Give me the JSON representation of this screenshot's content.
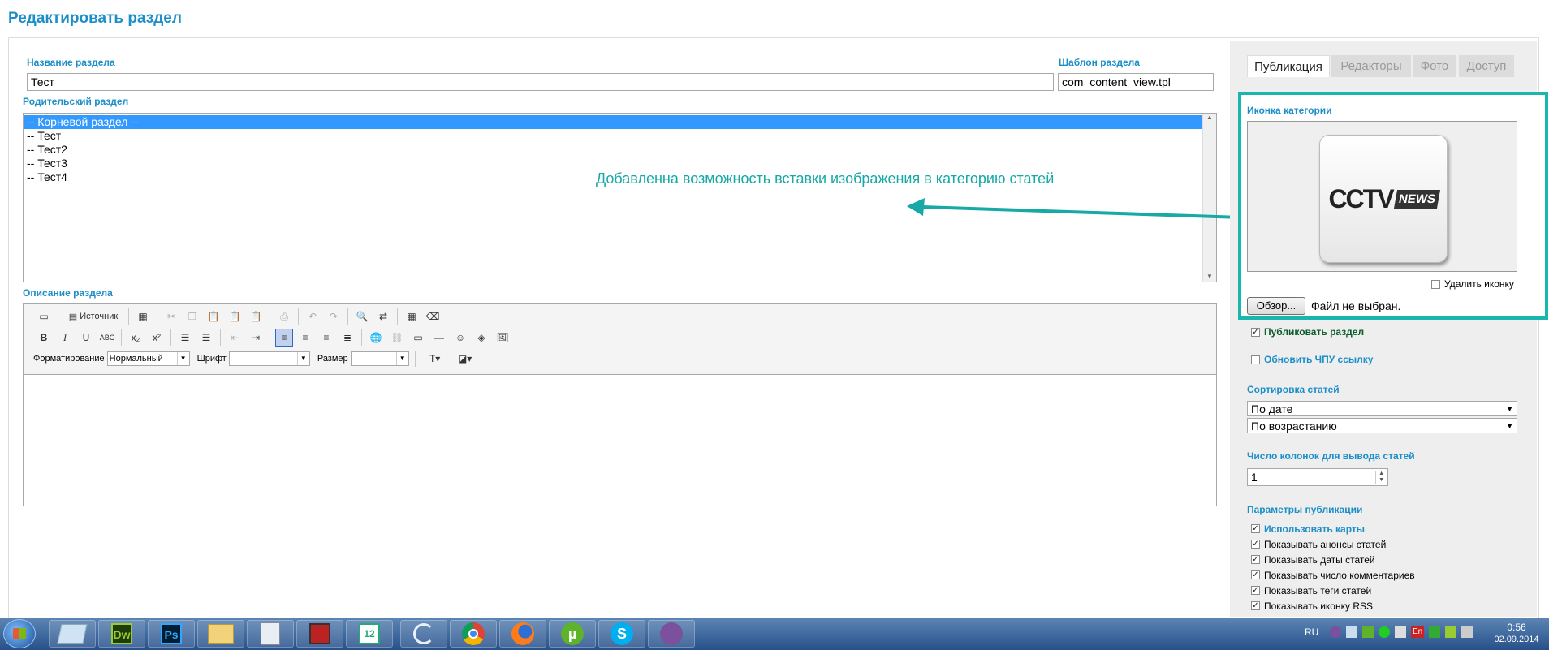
{
  "page": {
    "title": "Редактировать раздел"
  },
  "form": {
    "name_label": "Название раздела",
    "name_value": "Тест",
    "template_label": "Шаблон раздела",
    "template_value": "com_content_view.tpl",
    "parent_label": "Родительский раздел",
    "parent_items": [
      "-- Корневой раздел --",
      "-- Тест",
      "-- Тест2",
      "-- Тест3",
      "-- Тест4"
    ],
    "description_label": "Описание раздела"
  },
  "annotation": {
    "text": "Добавленна возможность вставки изображения в категорию статей",
    "color": "#17a9a5"
  },
  "editor": {
    "source_label": "Источник",
    "format_label": "Форматирование",
    "format_value": "Нормальный",
    "font_label": "Шрифт",
    "font_value": "",
    "size_label": "Размер",
    "size_value": ""
  },
  "tabs": [
    {
      "label": "Публикация",
      "active": true
    },
    {
      "label": "Редакторы",
      "active": false
    },
    {
      "label": "Фото",
      "active": false
    },
    {
      "label": "Доступ",
      "active": false
    }
  ],
  "category_icon": {
    "label": "Иконка категории",
    "logo_main": "CCTV",
    "logo_sub": "NEWS",
    "delete_label": "Удалить иконку",
    "browse_label": "Обзор...",
    "file_status": "Файл не выбран."
  },
  "publish": {
    "publish_label": "Публиковать раздел",
    "publish_checked": true,
    "update_url_label": "Обновить ЧПУ ссылку",
    "update_url_checked": false
  },
  "sorting": {
    "label": "Сортировка статей",
    "by_value": "По дате",
    "order_value": "По возрастанию"
  },
  "columns": {
    "label": "Число колонок для вывода статей",
    "value": "1"
  },
  "pub_params": {
    "label": "Параметры публикации",
    "items": [
      {
        "label": "Использовать карты",
        "checked": true,
        "accent": true
      },
      {
        "label": "Показывать анонсы статей",
        "checked": true
      },
      {
        "label": "Показывать даты статей",
        "checked": true
      },
      {
        "label": "Показывать число комментариев",
        "checked": true
      },
      {
        "label": "Показывать теги статей",
        "checked": true
      },
      {
        "label": "Показывать иконку RSS",
        "checked": true
      }
    ]
  },
  "taskbar": {
    "apps": [
      "explorer-icon",
      "dreamweaver-icon",
      "photoshop-icon",
      "folder-icon",
      "calculator-icon",
      "save-disk-icon",
      "total-commander-icon",
      "link-icon",
      "chrome-icon",
      "firefox-icon",
      "utorrent-icon",
      "skype-icon",
      "viber-icon"
    ],
    "dw_label": "Dw",
    "ps_label": "Ps",
    "tc_label": "12",
    "lang": "RU",
    "tray_lang": "En",
    "time": "0:56",
    "date": "02.09.2014"
  },
  "colors": {
    "accent": "#1c8ec8",
    "highlight": "#1ab6ae",
    "selection": "#3399ff"
  }
}
